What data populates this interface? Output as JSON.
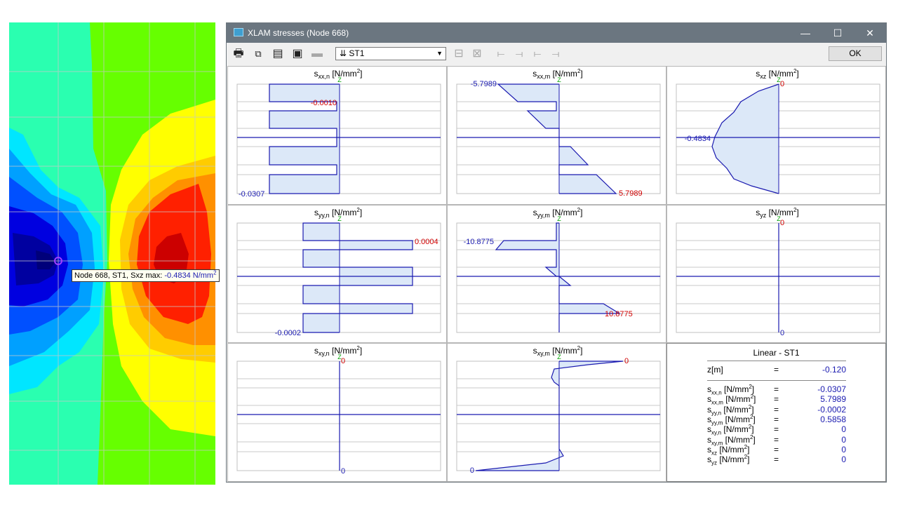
{
  "tooltip": {
    "text": "Node 668, ST1, Sxz max: ",
    "value": "-0.4834",
    "unit_base": "N/mm",
    "unit_exp": "2"
  },
  "window": {
    "title": "XLAM stresses (Node 668)",
    "minimize": "—",
    "maximize": "☐",
    "close": "✕"
  },
  "toolbar": {
    "icons": [
      "printer-icon",
      "copy-icon",
      "table-icon",
      "report-icon",
      "export-icon",
      "section-icon",
      "section-2-icon",
      "line-icon",
      "line-2-icon",
      "line-3-icon",
      "line-4-icon"
    ],
    "load_case": "ST1",
    "load_case_prefix": "⇊",
    "ok_label": "OK"
  },
  "panels": [
    {
      "id": "sxx-n",
      "t_base": "s",
      "t_sub": "xx,n",
      "t_unit": "[N/mm",
      "t_exp": "2",
      "t_end": "]",
      "z": "Z",
      "labels": [
        {
          "text": "-0.0010",
          "color": "#d00000"
        },
        {
          "text": "-0.0307",
          "color": "#1a1ab0"
        }
      ]
    },
    {
      "id": "sxx-m",
      "t_base": "s",
      "t_sub": "xx,m",
      "t_unit": "[N/mm",
      "t_exp": "2",
      "t_end": "]",
      "z": "Z",
      "labels": [
        {
          "text": "-5.7989",
          "color": "#1a1ab0"
        },
        {
          "text": "5.7989",
          "color": "#d00000"
        }
      ]
    },
    {
      "id": "sxz",
      "t_base": "s",
      "t_sub": "xz",
      "t_unit": "[N/mm",
      "t_exp": "2",
      "t_end": "]",
      "z": "Z",
      "labels": [
        {
          "text": "0",
          "color": "#d00000"
        },
        {
          "text": "-0.4834",
          "color": "#1a1ab0"
        }
      ]
    },
    {
      "id": "syy-n",
      "t_base": "s",
      "t_sub": "yy,n",
      "t_unit": "[N/mm",
      "t_exp": "2",
      "t_end": "]",
      "z": "Z",
      "labels": [
        {
          "text": "0.0004",
          "color": "#d00000"
        },
        {
          "text": "-0.0002",
          "color": "#1a1ab0"
        }
      ]
    },
    {
      "id": "syy-m",
      "t_base": "s",
      "t_sub": "yy,m",
      "t_unit": "[N/mm",
      "t_exp": "2",
      "t_end": "]",
      "z": "Z",
      "labels": [
        {
          "text": "-10.8775",
          "color": "#1a1ab0"
        },
        {
          "text": "10.8775",
          "color": "#d00000"
        }
      ]
    },
    {
      "id": "syz",
      "t_base": "s",
      "t_sub": "yz",
      "t_unit": "[N/mm",
      "t_exp": "2",
      "t_end": "]",
      "z": "Z",
      "labels": [
        {
          "text": "0",
          "color": "#d00000"
        },
        {
          "text": "0",
          "color": "#1a1ab0"
        }
      ]
    },
    {
      "id": "sxy-n",
      "t_base": "s",
      "t_sub": "xy,n",
      "t_unit": "[N/mm",
      "t_exp": "2",
      "t_end": "]",
      "z": "Z",
      "labels": [
        {
          "text": "0",
          "color": "#d00000"
        },
        {
          "text": "0",
          "color": "#1a1ab0"
        }
      ]
    },
    {
      "id": "sxy-m",
      "t_base": "s",
      "t_sub": "xy,m",
      "t_unit": "[N/mm",
      "t_exp": "2",
      "t_end": "]",
      "z": "Z",
      "labels": [
        {
          "text": "0",
          "color": "#d00000"
        },
        {
          "text": "0",
          "color": "#1a1ab0"
        }
      ]
    }
  ],
  "info": {
    "title": "Linear - ST1",
    "z_label": "z[m]",
    "eq": "=",
    "z_value": "-0.120",
    "rows": [
      {
        "base": "s",
        "sub": "xx,n",
        "unit": " [N/mm",
        "exp": "2",
        "end": "]",
        "value": "-0.0307"
      },
      {
        "base": "s",
        "sub": "xx,m",
        "unit": " [N/mm",
        "exp": "2",
        "end": "]",
        "value": "5.7989"
      },
      {
        "base": "s",
        "sub": "yy,n",
        "unit": " [N/mm",
        "exp": "2",
        "end": "]",
        "value": "-0.0002"
      },
      {
        "base": "s",
        "sub": "yy,m",
        "unit": " [N/mm",
        "exp": "2",
        "end": "]",
        "value": "0.5858"
      },
      {
        "base": "s",
        "sub": "xy,n",
        "unit": " [N/mm",
        "exp": "2",
        "end": "]",
        "value": "0"
      },
      {
        "base": "s",
        "sub": "xy,m",
        "unit": " [N/mm",
        "exp": "2",
        "end": "]",
        "value": "0"
      },
      {
        "base": "s",
        "sub": "xz",
        "unit": " [N/mm",
        "exp": "2",
        "end": "]",
        "value": "0"
      },
      {
        "base": "s",
        "sub": "yz",
        "unit": " [N/mm",
        "exp": "2",
        "end": "]",
        "value": "0"
      }
    ]
  },
  "colors": {
    "curve": "#1a1ab0",
    "fill": "#dce8f8",
    "max_label": "#d00000",
    "min_label": "#1a1ab0",
    "z_axis": "#00a000"
  }
}
